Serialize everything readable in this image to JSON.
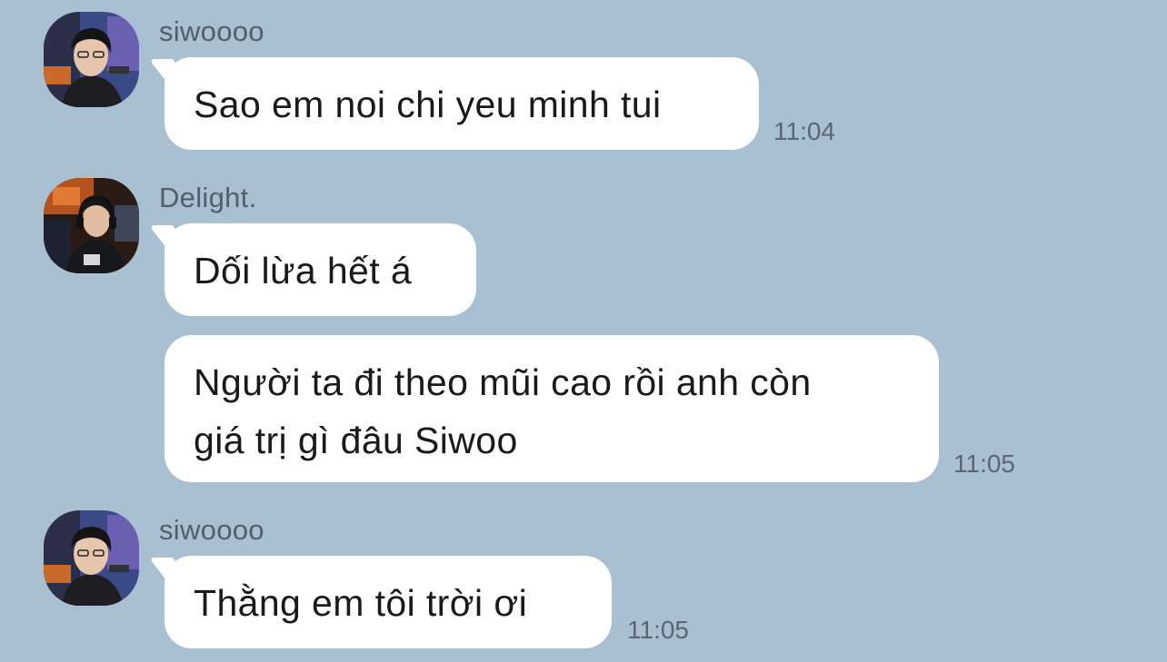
{
  "chat": {
    "messages": [
      {
        "sender": "siwoooo",
        "avatar": "siwoooo-avatar",
        "bubbles": [
          {
            "text": "Sao em noi chi yeu minh tui",
            "time": "11:04"
          }
        ]
      },
      {
        "sender": "Delight.",
        "avatar": "delight-avatar",
        "bubbles": [
          {
            "text": "Dối lừa hết á",
            "time": ""
          },
          {
            "line1": "Người ta đi theo mũi cao rồi anh còn",
            "line2": "giá trị gì đâu Siwoo",
            "time": "11:05"
          }
        ]
      },
      {
        "sender": "siwoooo",
        "avatar": "siwoooo-avatar",
        "bubbles": [
          {
            "text": "Thằng em tôi trời ơi",
            "time": "11:05"
          }
        ]
      }
    ]
  },
  "colors": {
    "background": "#a9bfd2",
    "bubble": "#ffffff",
    "sender_text": "#555e68",
    "time_text": "#5d6670"
  }
}
